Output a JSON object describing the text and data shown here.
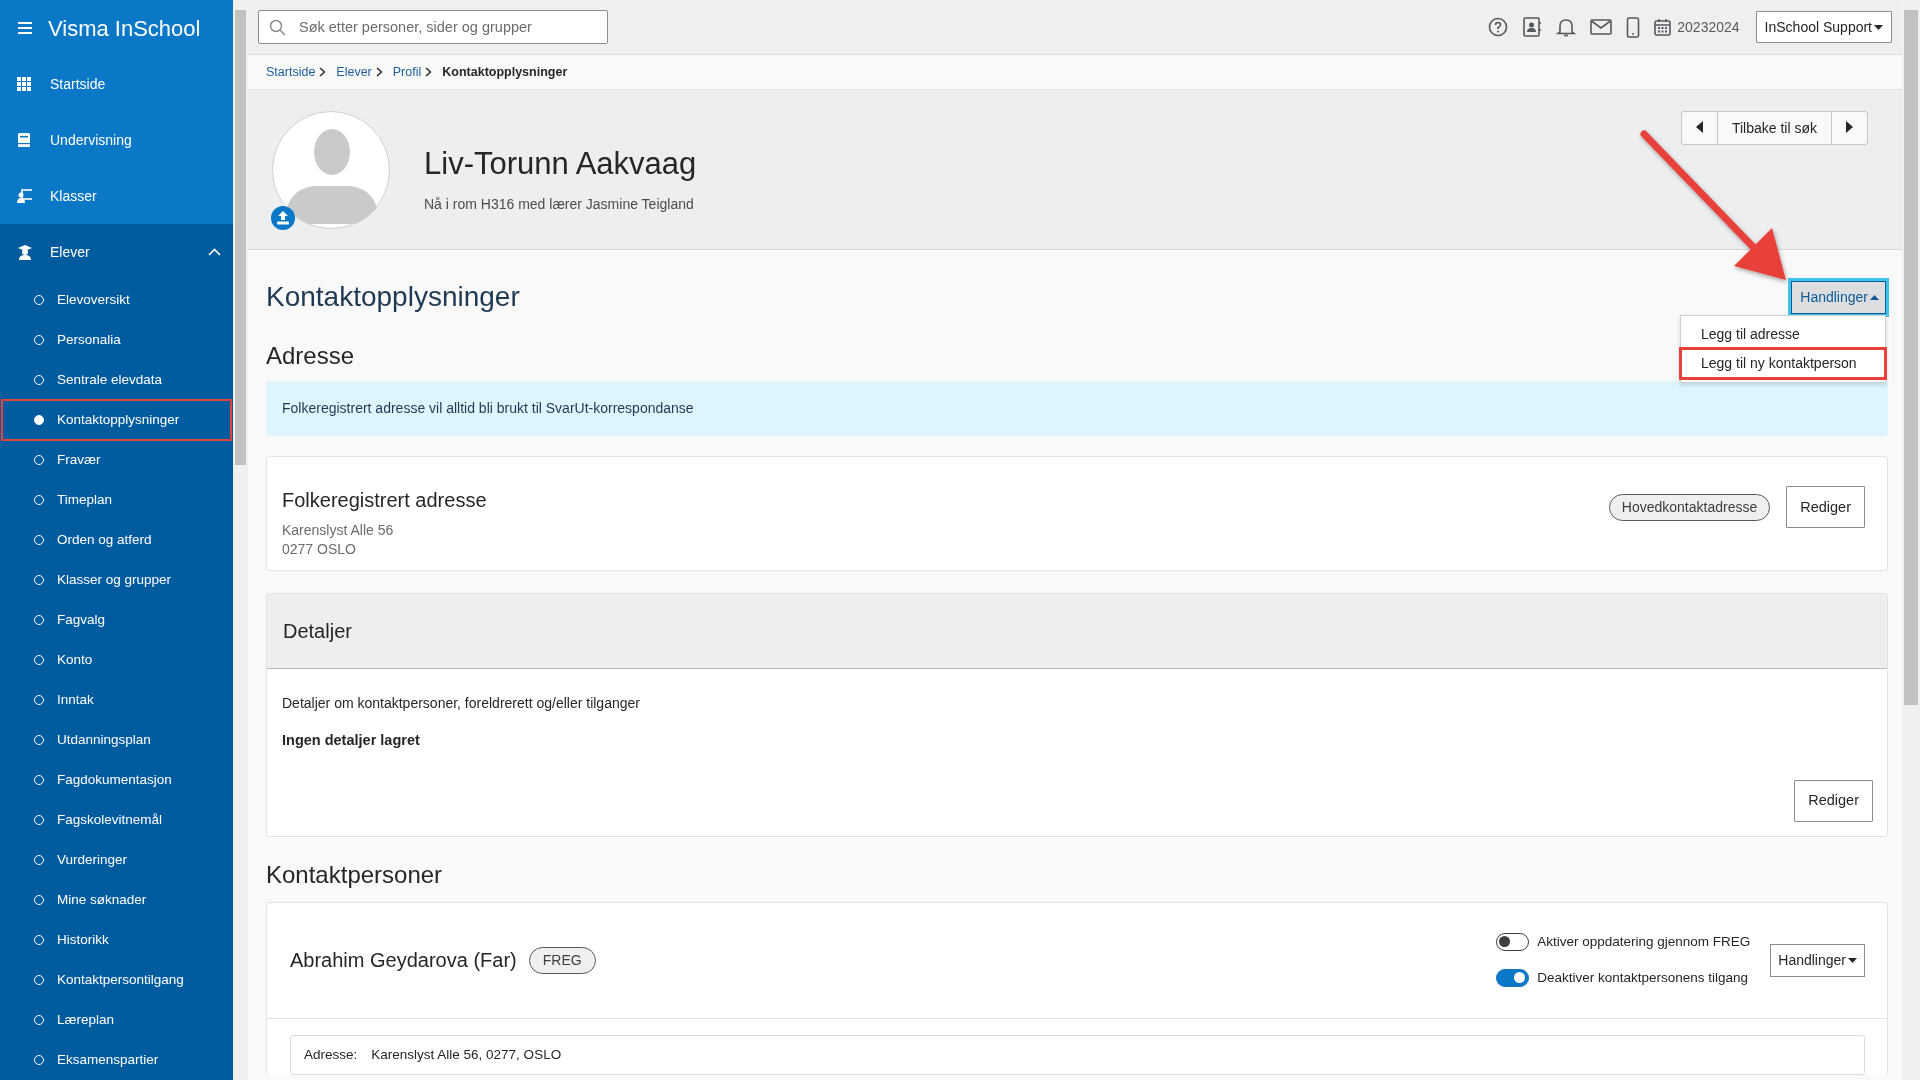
{
  "sidebar": {
    "brand": "Visma InSchool",
    "items": [
      {
        "label": "Startside",
        "selected": false
      },
      {
        "label": "Undervisning",
        "selected": false
      },
      {
        "label": "Klasser",
        "selected": false
      },
      {
        "label": "Elever",
        "selected": false,
        "expanded": true,
        "children": [
          {
            "label": "Elevoversikt",
            "selected": false,
            "annotated": false
          },
          {
            "label": "Personalia",
            "selected": false,
            "annotated": false
          },
          {
            "label": "Sentrale elevdata",
            "selected": false,
            "annotated": false
          },
          {
            "label": "Kontaktopplysninger",
            "selected": true,
            "annotated": true
          },
          {
            "label": "Fravær",
            "selected": false,
            "annotated": false
          },
          {
            "label": "Timeplan",
            "selected": false,
            "annotated": false
          },
          {
            "label": "Orden og atferd",
            "selected": false,
            "annotated": false
          },
          {
            "label": "Klasser og grupper",
            "selected": false,
            "annotated": false
          },
          {
            "label": "Fagvalg",
            "selected": false,
            "annotated": false
          },
          {
            "label": "Konto",
            "selected": false,
            "annotated": false
          },
          {
            "label": "Inntak",
            "selected": false,
            "annotated": false
          },
          {
            "label": "Utdanningsplan",
            "selected": false,
            "annotated": false
          },
          {
            "label": "Fagdokumentasjon",
            "selected": false,
            "annotated": false
          },
          {
            "label": "Fagskolevitnemål",
            "selected": false,
            "annotated": false
          },
          {
            "label": "Vurderinger",
            "selected": false,
            "annotated": false
          },
          {
            "label": "Mine søknader",
            "selected": false,
            "annotated": false
          },
          {
            "label": "Historikk",
            "selected": false,
            "annotated": false
          },
          {
            "label": "Kontaktpersontilgang",
            "selected": false,
            "annotated": false
          },
          {
            "label": "Læreplan",
            "selected": false,
            "annotated": false
          },
          {
            "label": "Eksamenspartier",
            "selected": false,
            "annotated": false
          }
        ]
      }
    ]
  },
  "topbar": {
    "search": {
      "placeholder": "Søk etter personer, sider og grupper"
    },
    "term": "20232024",
    "user_menu": "InSchool Support"
  },
  "breadcrumb": [
    {
      "label": "Startside",
      "current": false
    },
    {
      "label": "Elever",
      "current": false
    },
    {
      "label": "Profil",
      "current": false
    },
    {
      "label": "Kontaktopplysninger",
      "current": true
    }
  ],
  "profile": {
    "name": "Liv-Torunn Aakvaag",
    "status": "Nå i rom H316 med lærer Jasmine Teigland",
    "back_button": "Tilbake til søk"
  },
  "page_title": "Kontaktopplysninger",
  "actions_menu": {
    "label": "Handlinger",
    "expanded": true,
    "items": [
      {
        "label": "Legg til adresse",
        "annotated": false
      },
      {
        "label": "Legg til ny kontaktperson",
        "annotated": true
      }
    ]
  },
  "address": {
    "heading": "Adresse",
    "alert": "Folkeregistrert adresse vil alltid bli brukt til SvarUt-korrespondanse",
    "card": {
      "title": "Folkeregistrert adresse",
      "lines": [
        "Karenslyst Alle 56",
        "0277 OSLO"
      ],
      "badge": "Hovedkontaktadresse",
      "button": "Rediger"
    }
  },
  "details": {
    "heading": "Detaljer",
    "description": "Detaljer om kontaktpersoner, foreldrerett og/eller tilganger",
    "value": "Ingen detaljer lagret",
    "button": "Rediger"
  },
  "contacts": {
    "heading": "Kontaktpersoner",
    "items": [
      {
        "name": "Abrahim Geydarova (Far)",
        "badge": "FREG",
        "toggles": [
          {
            "label": "Aktiver oppdatering gjennom FREG",
            "on": false
          },
          {
            "label": "Deaktiver kontaktpersonens tilgang",
            "on": true
          }
        ],
        "menu": "Handlinger",
        "address_label": "Adresse:",
        "address_value": "Karenslyst Alle 56, 0277, OSLO"
      }
    ]
  }
}
